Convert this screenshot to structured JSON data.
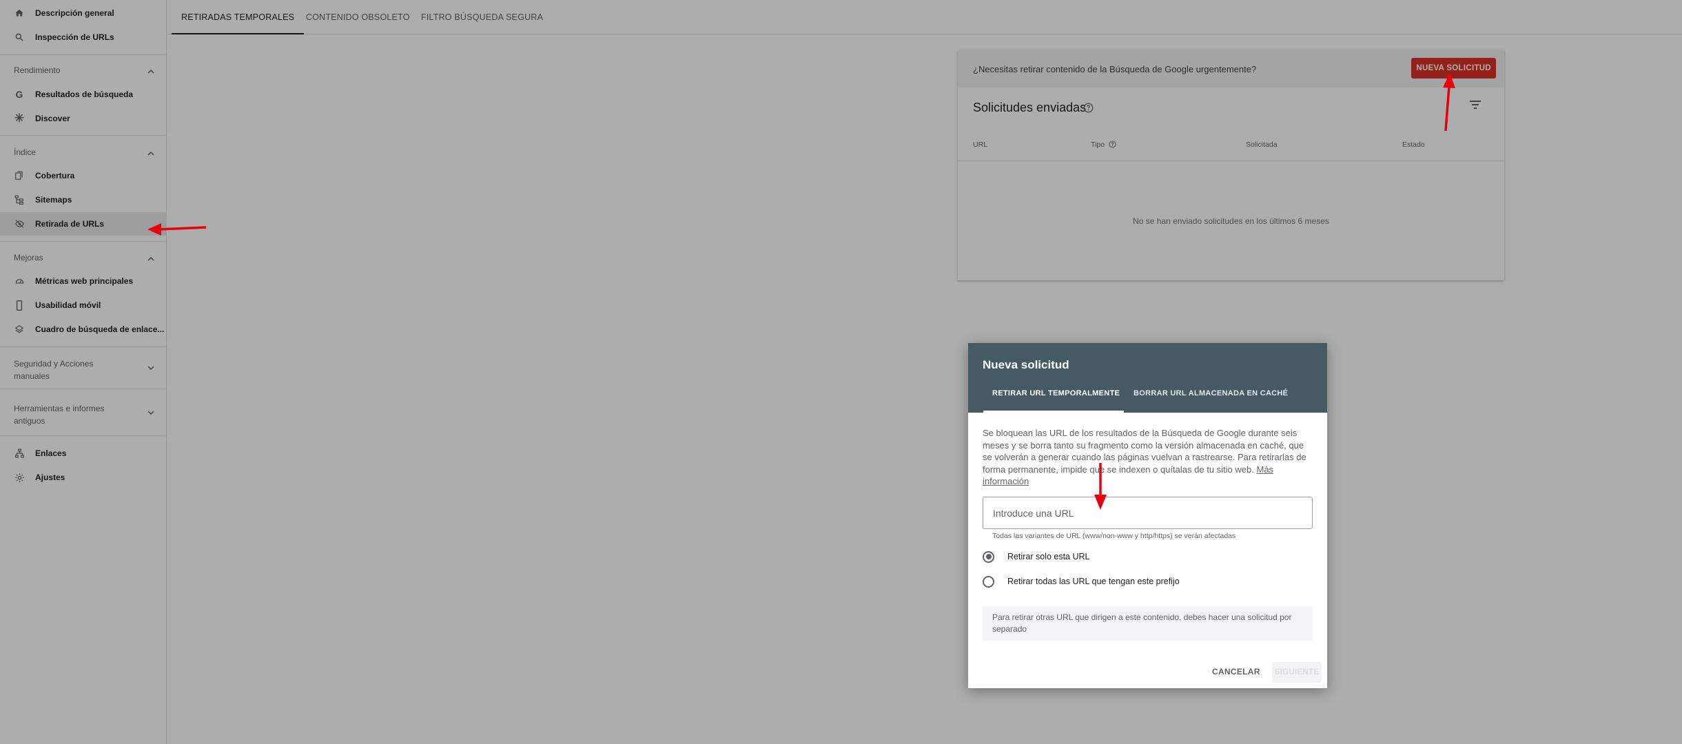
{
  "sidebar": {
    "items_top": [
      {
        "label": "Descripción general",
        "icon": "home-icon"
      },
      {
        "label": "Inspección de URLs",
        "icon": "search-icon"
      }
    ],
    "rendimiento": {
      "title": "Rendimiento",
      "items": [
        {
          "label": "Resultados de búsqueda",
          "icon": "google-g-icon"
        },
        {
          "label": "Discover",
          "icon": "asterisk-icon"
        }
      ]
    },
    "indice": {
      "title": "Índice",
      "items": [
        {
          "label": "Cobertura",
          "icon": "file-copy-icon"
        },
        {
          "label": "Sitemaps",
          "icon": "sitemap-icon"
        },
        {
          "label": "Retirada de URLs",
          "icon": "eye-off-icon",
          "active": true
        }
      ]
    },
    "mejoras": {
      "title": "Mejoras",
      "items": [
        {
          "label": "Métricas web principales",
          "icon": "speed-icon"
        },
        {
          "label": "Usabilidad móvil",
          "icon": "smartphone-icon"
        },
        {
          "label": "Cuadro de búsqueda de enlace...",
          "icon": "layers-icon"
        }
      ]
    },
    "seguridad": {
      "line1": "Seguridad y Acciones",
      "line2": "manuales"
    },
    "herramientas": {
      "line1": "Herramientas e informes",
      "line2": "antiguos"
    },
    "items_bottom": [
      {
        "label": "Enlaces",
        "icon": "links-icon"
      },
      {
        "label": "Ajustes",
        "icon": "settings-icon"
      }
    ]
  },
  "tabs": [
    "RETIRADAS TEMPORALES",
    "CONTENIDO OBSOLETO",
    "FILTRO BÚSQUEDA SEGURA"
  ],
  "card": {
    "banner_text": "¿Necesitas retirar contenido de la Búsqueda de Google urgentemente?",
    "new_request_label": "NUEVA SOLICITUD",
    "title": "Solicitudes enviadas",
    "columns": [
      "URL",
      "Tipo",
      "Solicitada",
      "Estado"
    ],
    "empty_message": "No se han enviado solicitudes en los últimos 6 meses"
  },
  "dialog": {
    "title": "Nueva solicitud",
    "tabs": [
      "RETIRAR URL TEMPORALMENTE",
      "BORRAR URL ALMACENADA EN CACHÉ"
    ],
    "description": "Se bloquean las URL de los resultados de la Búsqueda de Google durante seis meses y se borra tanto su fragmento como la versión almacenada en caché, que se volverán a generar cuando las páginas vuelvan a rastrearse. Para retirarlas de forma permanente, impide que se indexen o quítalas de tu sitio web.",
    "more_info": "Más información",
    "url_placeholder": "Introduce una URL",
    "url_value": "",
    "url_hint": "Todas las variantes de URL (www/non-www y http/https) se verán afectadas",
    "radio_options": [
      {
        "label": "Retirar solo esta URL",
        "selected": true
      },
      {
        "label": "Retirar todas las URL que tengan este prefijo",
        "selected": false
      }
    ],
    "note": "Para retirar otras URL que dirigen a este contenido, debes hacer una solicitud por separado",
    "cancel_label": "CANCELAR",
    "next_label": "SIGUIENTE"
  },
  "colors": {
    "accent_red": "#d93025",
    "dialog_header": "#455a64",
    "annotation_arrow": "#e8000b"
  }
}
